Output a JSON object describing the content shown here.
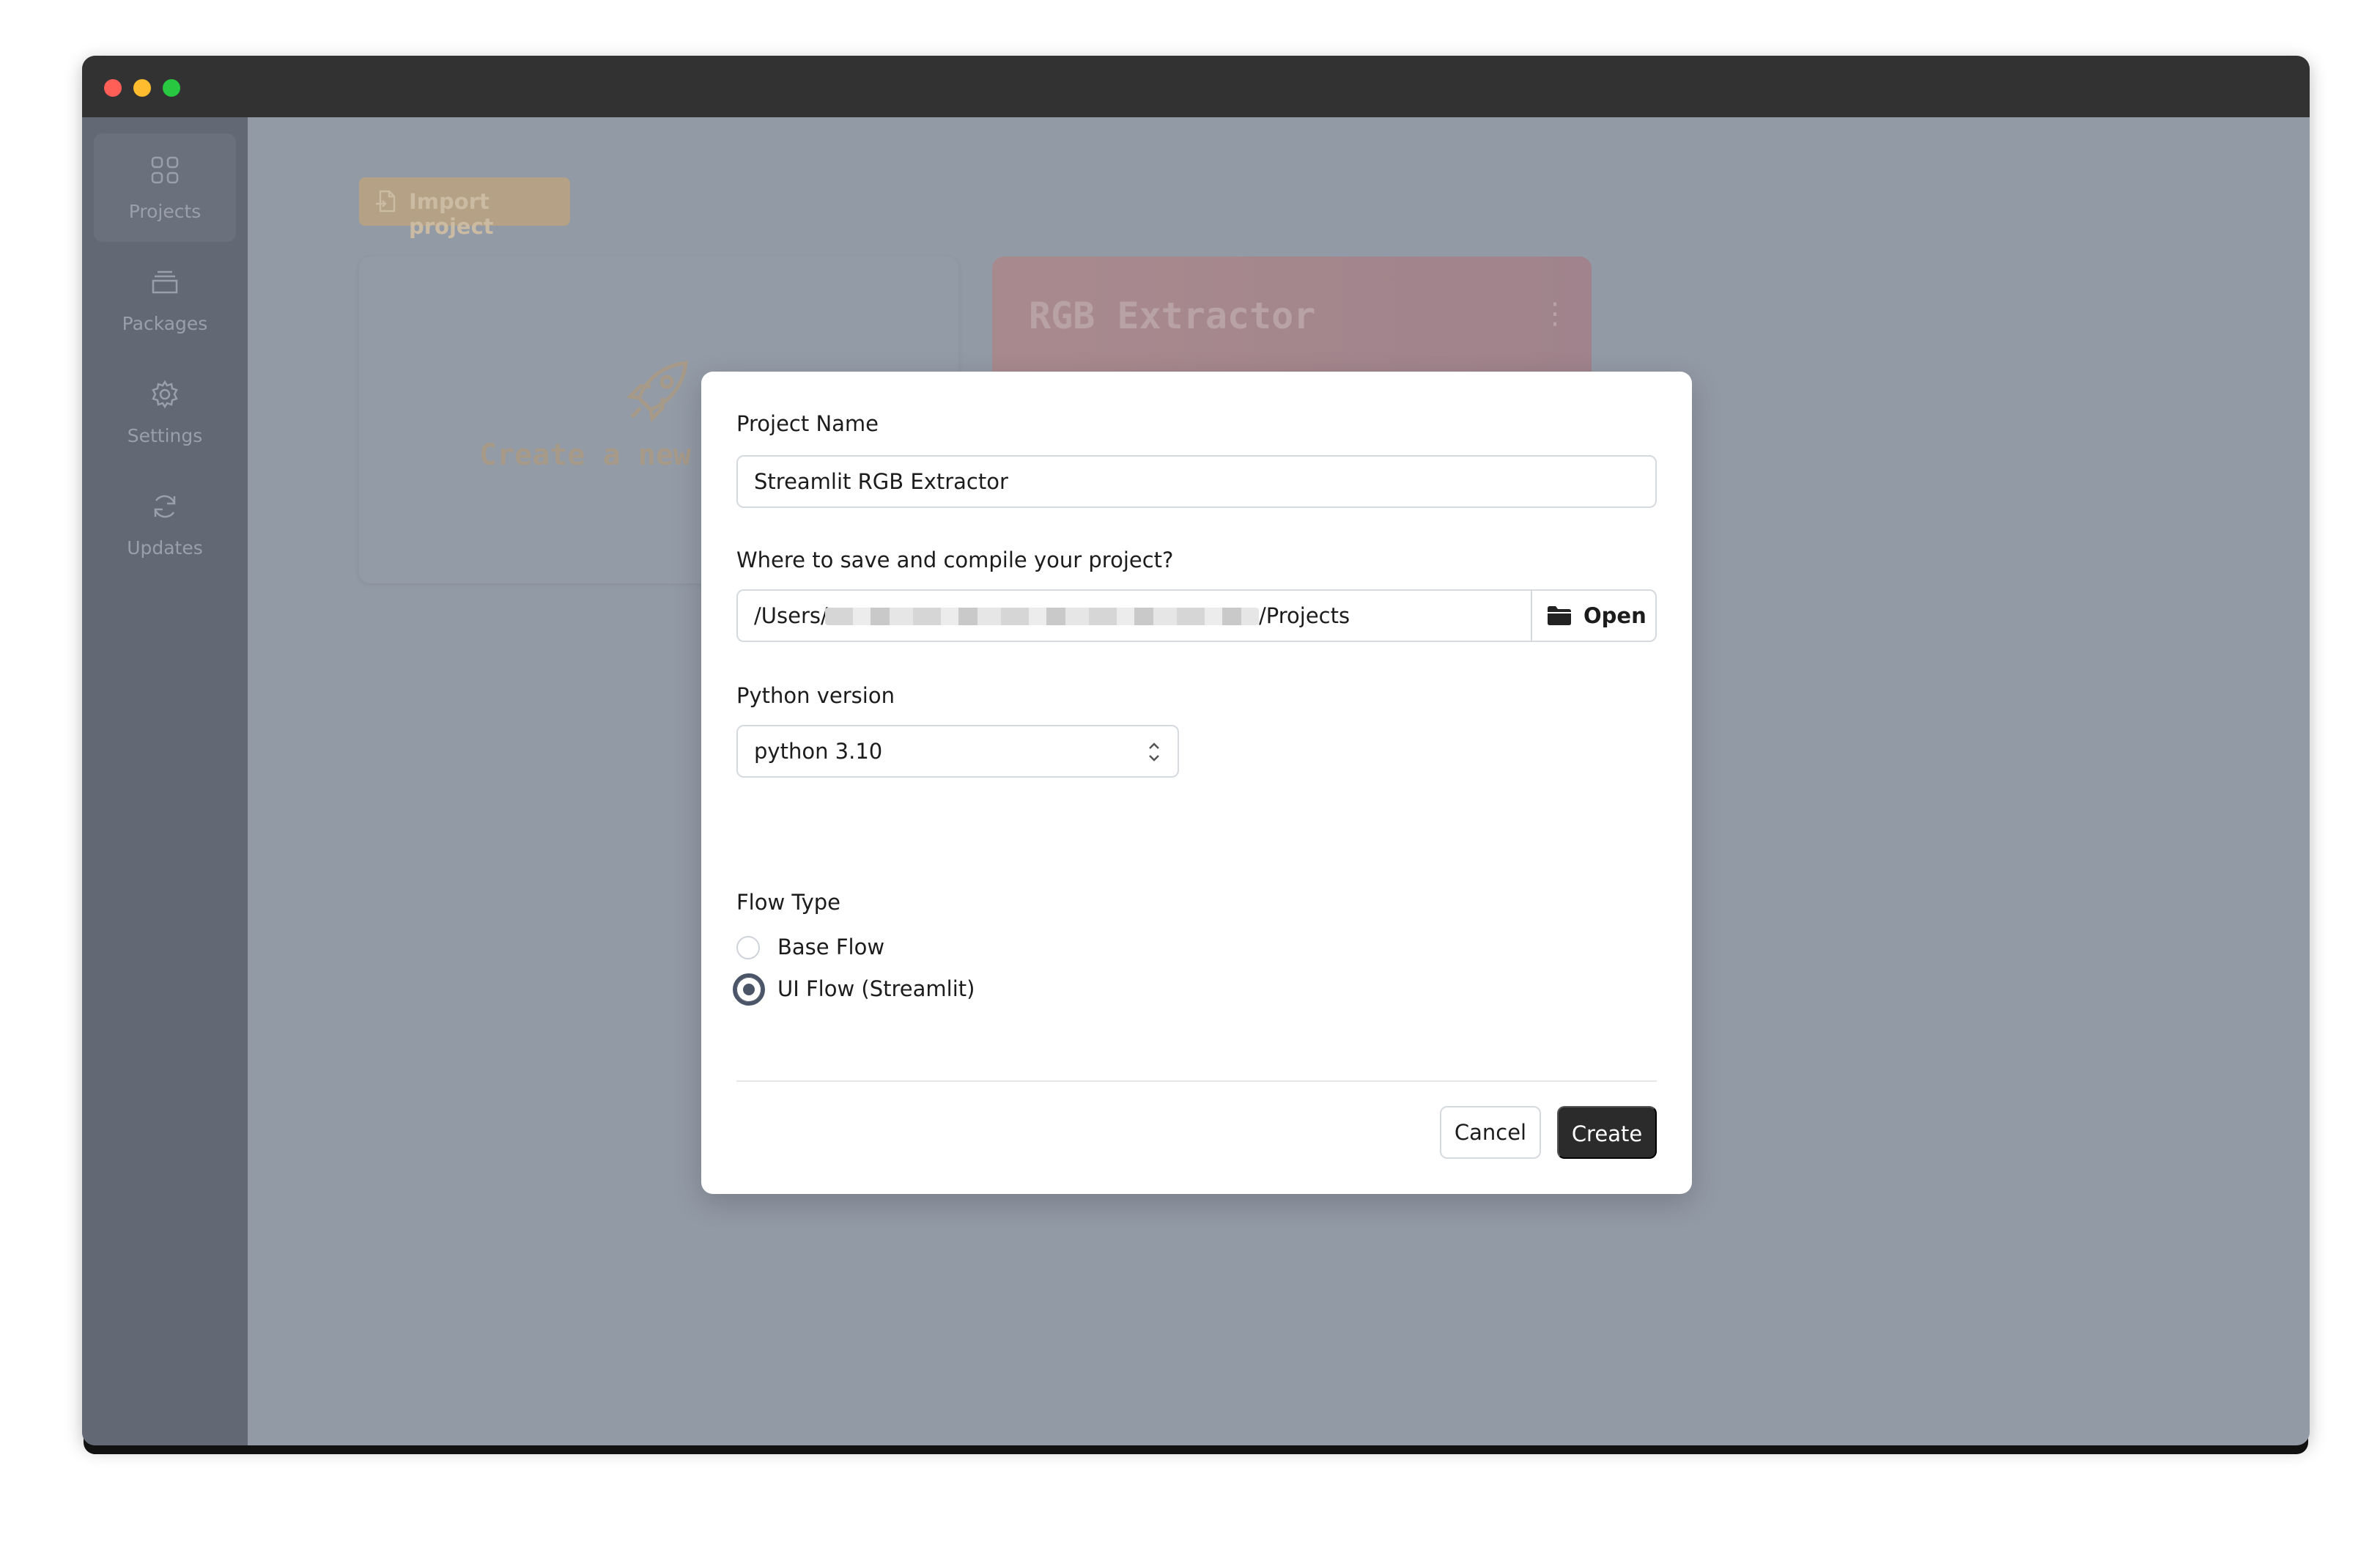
{
  "sidebar": {
    "items": [
      {
        "label": "Projects",
        "icon": "grid-icon",
        "active": true
      },
      {
        "label": "Packages",
        "icon": "package-icon",
        "active": false
      },
      {
        "label": "Settings",
        "icon": "gear-icon",
        "active": false
      },
      {
        "label": "Updates",
        "icon": "refresh-icon",
        "active": false
      }
    ]
  },
  "main": {
    "import_label": "Import project",
    "new_card_text": "Create a new",
    "project_card_title": "RGB Extractor"
  },
  "modal": {
    "project_name_label": "Project Name",
    "project_name_value": "Streamlit RGB Extractor",
    "save_location_label": "Where to save and compile your project?",
    "save_location_prefix": "/Users/",
    "save_location_suffix": "/Projects",
    "open_label": "Open",
    "python_version_label": "Python version",
    "python_version_value": "python 3.10",
    "flow_type_label": "Flow Type",
    "flow_options": [
      {
        "label": "Base Flow",
        "checked": false
      },
      {
        "label": "UI Flow (Streamlit)",
        "checked": true
      }
    ],
    "cancel_label": "Cancel",
    "create_label": "Create"
  },
  "colors": {
    "overlay": "#929aa6",
    "sidebar": "#626874",
    "titlebar": "#323232",
    "primary_button": "#2b2b2b",
    "radio_accent": "#4a5568"
  }
}
